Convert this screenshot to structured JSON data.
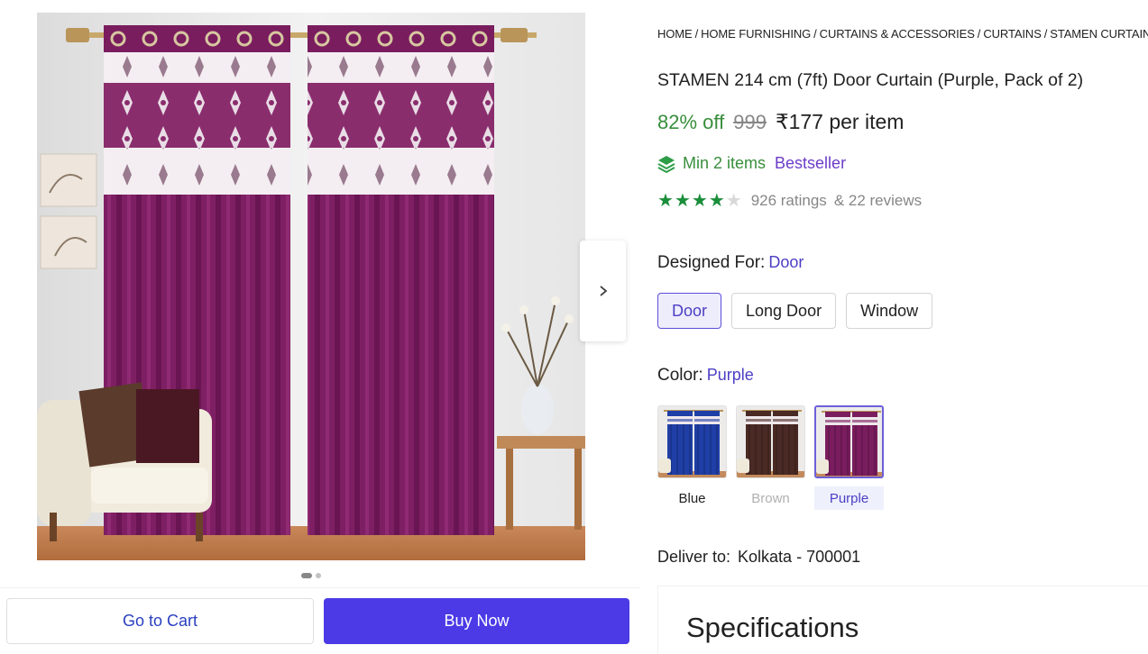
{
  "gallery": {
    "next_icon": "chevron-right-icon",
    "image_count": 2,
    "active_index": 0
  },
  "actions": {
    "cart_label": "Go to Cart",
    "buy_label": "Buy Now"
  },
  "breadcrumb": [
    "HOME",
    "HOME FURNISHING",
    "CURTAINS & ACCESSORIES",
    "CURTAINS",
    "STAMEN CURTAINS"
  ],
  "product": {
    "title": "STAMEN 214 cm (7ft) Door Curtain (Purple, Pack of 2)",
    "discount": "82% off",
    "mrp": "999",
    "price": "₹177 per item",
    "offer_icon": "layers-icon",
    "min_items": "Min 2 items",
    "badge": "Bestseller",
    "rating": 4,
    "rating_max": 5,
    "ratings_text": "926 ratings",
    "reviews_text": "& 22 reviews"
  },
  "designed_for": {
    "label": "Designed For:",
    "selected": "Door",
    "options": [
      "Door",
      "Long Door",
      "Window"
    ]
  },
  "color": {
    "label": "Color:",
    "selected": "Purple",
    "options": [
      {
        "name": "Blue",
        "swatch": "#1f3fa6",
        "state": "available"
      },
      {
        "name": "Brown",
        "swatch": "#4a2a24",
        "state": "unavailable"
      },
      {
        "name": "Purple",
        "swatch": "#7a1d5e",
        "state": "selected"
      }
    ]
  },
  "delivery": {
    "label": "Deliver to:",
    "location": "Kolkata - 700001"
  },
  "specifications": {
    "title": "Specifications"
  },
  "colors": {
    "accent": "#4b3ae6",
    "discount_green": "#388e3c",
    "curtain_purple": "#7a1d5e",
    "star_green": "#1a8e3a"
  }
}
